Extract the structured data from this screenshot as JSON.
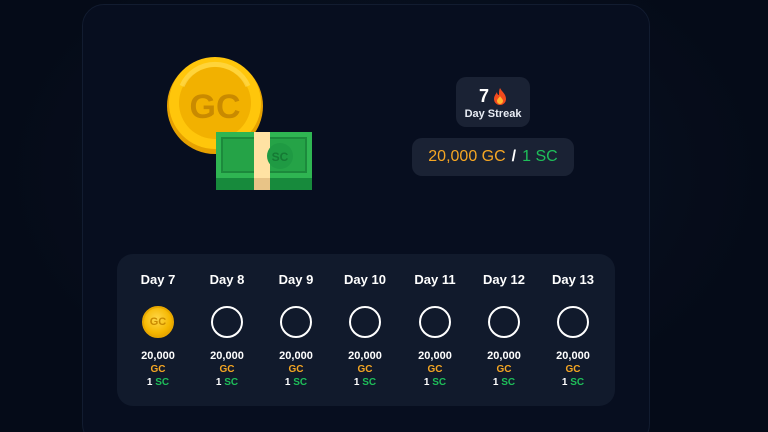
{
  "streak": {
    "count": "7",
    "icon": "fire-icon",
    "label": "Day Streak"
  },
  "reward": {
    "gc": "20,000 GC",
    "separator": "/",
    "sc": "1 SC"
  },
  "hero": {
    "coin_text": "GC",
    "bill_text": "SC"
  },
  "days": [
    {
      "label": "Day 7",
      "claimed": true,
      "token_text": "GC",
      "amount": "20,000",
      "gc": "GC",
      "sc_count": "1",
      "sc": "SC"
    },
    {
      "label": "Day 8",
      "claimed": false,
      "amount": "20,000",
      "gc": "GC",
      "sc_count": "1",
      "sc": "SC"
    },
    {
      "label": "Day 9",
      "claimed": false,
      "amount": "20,000",
      "gc": "GC",
      "sc_count": "1",
      "sc": "SC"
    },
    {
      "label": "Day 10",
      "claimed": false,
      "amount": "20,000",
      "gc": "GC",
      "sc_count": "1",
      "sc": "SC"
    },
    {
      "label": "Day 11",
      "claimed": false,
      "amount": "20,000",
      "gc": "GC",
      "sc_count": "1",
      "sc": "SC"
    },
    {
      "label": "Day 12",
      "claimed": false,
      "amount": "20,000",
      "gc": "GC",
      "sc_count": "1",
      "sc": "SC"
    },
    {
      "label": "Day 13",
      "claimed": false,
      "amount": "20,000",
      "gc": "GC",
      "sc_count": "1",
      "sc": "SC"
    }
  ],
  "colors": {
    "gc": "#f5a623",
    "sc": "#1fbf5a",
    "panel": "#1a2234",
    "background": "#050b18"
  }
}
